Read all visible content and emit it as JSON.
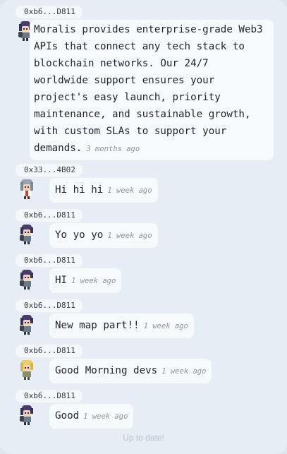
{
  "messages": [
    {
      "sender": "0xb6...D811",
      "avatar": "purple-hair-character-icon",
      "text": "Moralis provides enterprise-grade Web3 APIs that connect any tech stack to blockchain networks. Our 24/7 worldwide support ensures your project's easy launch, priority maintenance, and sustainable growth, with custom SLAs to support your demands.",
      "time": "3 months ago"
    },
    {
      "sender": "0x33...4B02",
      "avatar": "gray-hair-character-icon",
      "text": "Hi hi hi",
      "time": "1 week ago"
    },
    {
      "sender": "0xb6...D811",
      "avatar": "purple-hair-character-icon",
      "text": "Yo yo yo",
      "time": "1 week ago"
    },
    {
      "sender": "0xb6...D811",
      "avatar": "purple-hair-character-icon",
      "text": "HI",
      "time": "1 week ago"
    },
    {
      "sender": "0xb6...D811",
      "avatar": "purple-hair-character-icon",
      "text": "New map part!!",
      "time": "1 week ago"
    },
    {
      "sender": "0xb6...D811",
      "avatar": "blonde-hair-character-icon",
      "text": "Good Morning devs",
      "time": "1 week ago"
    },
    {
      "sender": "0xb6...D811",
      "avatar": "purple-hair-character-icon",
      "text": "Good",
      "time": "1 week ago"
    }
  ],
  "footer": {
    "status": "Up to date!"
  },
  "colors": {
    "background": "#e6edf4",
    "bubble": "#f7fafd",
    "timestamp": "#8a95a3",
    "footer": "#b7c2cf"
  }
}
